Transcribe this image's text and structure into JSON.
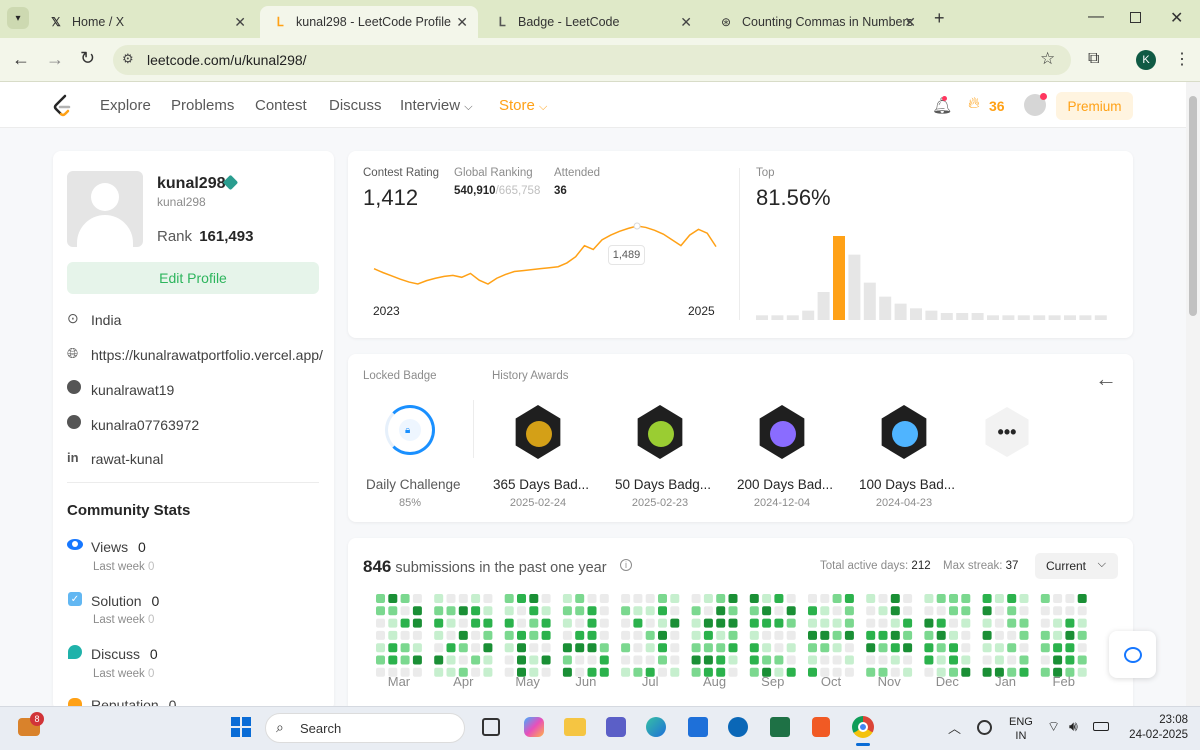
{
  "browser": {
    "tabs": [
      {
        "title": "Home / X"
      },
      {
        "title": "kunal298 - LeetCode Profile"
      },
      {
        "title": "Badge - LeetCode"
      },
      {
        "title": "Counting Commas in Numbers"
      }
    ],
    "url": "leetcode.com/u/kunal298/",
    "profile_initial": "K"
  },
  "nav": {
    "items": [
      "Explore",
      "Problems",
      "Contest",
      "Discuss",
      "Interview",
      "Store"
    ],
    "streak": "36",
    "premium": "Premium"
  },
  "profile": {
    "username": "kunal298",
    "handle": "kunal298",
    "rank_label": "Rank",
    "rank_value": "161,493",
    "edit_button": "Edit Profile",
    "location": "India",
    "website": "https://kunalrawatportfolio.vercel.app/",
    "github": "kunalrawat19",
    "twitter": "kunalra07763972",
    "linkedin": "rawat-kunal"
  },
  "community": {
    "title": "Community Stats",
    "stats": [
      {
        "label": "Views",
        "value": "0",
        "sub": "Last week",
        "sub_value": "0"
      },
      {
        "label": "Solution",
        "value": "0",
        "sub": "Last week",
        "sub_value": "0"
      },
      {
        "label": "Discuss",
        "value": "0",
        "sub": "Last week",
        "sub_value": "0"
      },
      {
        "label": "Reputation",
        "value": "0"
      }
    ]
  },
  "contest": {
    "rating_label": "Contest Rating",
    "rating": "1,412",
    "global_label": "Global Ranking",
    "global_rank": "540,910",
    "global_total": "/665,758",
    "attended_label": "Attended",
    "attended": "36",
    "tooltip": "1,489",
    "x_start": "2023",
    "x_end": "2025",
    "top_label": "Top",
    "top_value": "81.56%"
  },
  "chart_data": [
    {
      "type": "line",
      "x_labels": [
        "2023",
        "2025"
      ],
      "values": [
        1400,
        1392,
        1385,
        1378,
        1372,
        1368,
        1375,
        1380,
        1384,
        1386,
        1382,
        1390,
        1376,
        1368,
        1380,
        1388,
        1394,
        1396,
        1398,
        1400,
        1402,
        1404,
        1412,
        1425,
        1448,
        1440,
        1460,
        1470,
        1478,
        1484,
        1489,
        1486,
        1480,
        1472,
        1460,
        1448,
        1470,
        1482,
        1474,
        1446
      ],
      "highlight": {
        "index": 30,
        "value": 1489
      },
      "color": "#ffa116"
    },
    {
      "type": "bar",
      "values": [
        2,
        2,
        2,
        4,
        12,
        36,
        28,
        16,
        10,
        7,
        5,
        4,
        3,
        3,
        3,
        2,
        2,
        2,
        2,
        2,
        2,
        2,
        2
      ],
      "highlight_index": 5,
      "color": "#e6e6e6",
      "highlight_color": "#ffa116"
    }
  ],
  "badges": {
    "locked_label": "Locked Badge",
    "history_label": "History Awards",
    "locked": {
      "name": "Daily Challenge",
      "progress": "85%"
    },
    "items": [
      {
        "name": "365 Days Bad...",
        "date": "2025-02-24",
        "color": "#d4a017"
      },
      {
        "name": "50 Days Badg...",
        "date": "2025-02-23",
        "color": "#9acd32"
      },
      {
        "name": "200 Days Bad...",
        "date": "2024-12-04",
        "color": "#8a6cff"
      },
      {
        "name": "100 Days Bad...",
        "date": "2024-04-23",
        "color": "#4fb4ff"
      }
    ]
  },
  "submissions": {
    "count": "846",
    "text": "submissions in the past one year",
    "active_label": "Total active days:",
    "active_value": "212",
    "streak_label": "Max streak:",
    "streak_value": "37",
    "dropdown": "Current",
    "months": [
      "Mar",
      "Apr",
      "May",
      "Jun",
      "Jul",
      "Aug",
      "Sep",
      "Oct",
      "Nov",
      "Dec",
      "Jan",
      "Feb"
    ],
    "week_groups": [
      4,
      5,
      4,
      4,
      5,
      4,
      4,
      4,
      4,
      4,
      4,
      4
    ]
  },
  "taskbar": {
    "search": "Search",
    "notif_count": "8",
    "lang1": "ENG",
    "lang2": "IN",
    "time": "23:08",
    "date": "24-02-2025"
  }
}
